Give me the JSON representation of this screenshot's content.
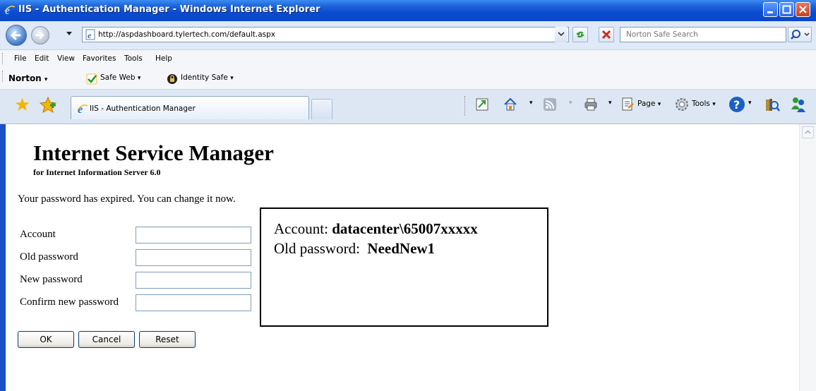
{
  "window": {
    "title": "IIS - Authentication Manager - Windows Internet Explorer"
  },
  "addressbar": {
    "url": "http://aspdashboard.tylertech.com/default.aspx"
  },
  "search": {
    "placeholder": "Norton Safe Search"
  },
  "menu": {
    "items": [
      "File",
      "Edit",
      "View",
      "Favorites",
      "Tools",
      "Help"
    ]
  },
  "norton": {
    "brand": "Norton",
    "safe_web": "Safe Web",
    "identity_safe": "Identity Safe"
  },
  "tab": {
    "title": "IIS - Authentication Manager"
  },
  "commandbar": {
    "page": "Page",
    "tools": "Tools"
  },
  "page": {
    "heading": "Internet Service Manager",
    "subheading": "for Internet Information Server 6.0",
    "message": "Your password has expired. You can change it now.",
    "form": {
      "account_label": "Account",
      "old_password_label": "Old password",
      "new_password_label": "New password",
      "confirm_password_label": "Confirm new password",
      "account_value": "",
      "old_password_value": "",
      "new_password_value": "",
      "confirm_password_value": ""
    },
    "buttons": {
      "ok": "OK",
      "cancel": "Cancel",
      "reset": "Reset"
    }
  },
  "callout": {
    "account_label": "Account:",
    "account_value": "datacenter\\65007xxxxx",
    "old_password_label": "Old password:",
    "old_password_value": "NeedNew1"
  }
}
